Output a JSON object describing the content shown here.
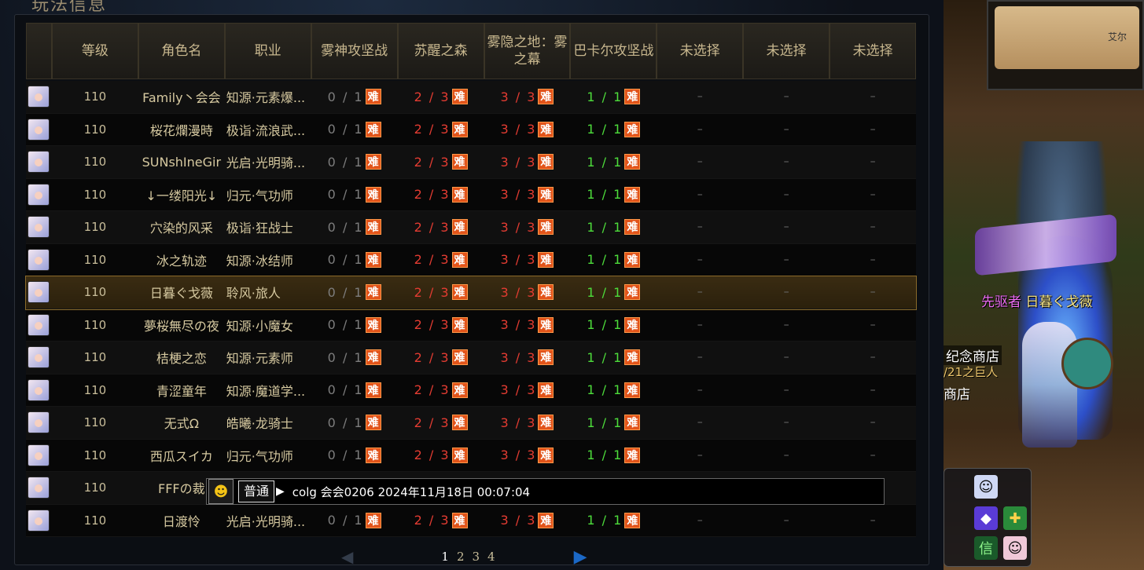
{
  "panel": {
    "title": "玩法信息"
  },
  "headers": [
    "等级",
    "角色名",
    "职业",
    "雾神攻坚战",
    "苏醒之森",
    "雾隐之地：雾之幕",
    "巴卡尔攻坚战",
    "未选择",
    "未选择",
    "未选择"
  ],
  "hard_badge": "难",
  "rows": [
    {
      "level": "110",
      "name": "Family丶会会",
      "job": "知源·元素爆...",
      "r1": "0 / 1",
      "r2": "2 / 3",
      "r3": "3 / 3",
      "r4": "1 / 1",
      "d1": "–",
      "d2": "–",
      "d3": "–"
    },
    {
      "level": "110",
      "name": "桜花爛漫時",
      "job": "极诣·流浪武...",
      "r1": "0 / 1",
      "r2": "2 / 3",
      "r3": "3 / 3",
      "r4": "1 / 1",
      "d1": "–",
      "d2": "–",
      "d3": "–"
    },
    {
      "level": "110",
      "name": "SUNshIneGir",
      "job": "光启·光明骑...",
      "r1": "0 / 1",
      "r2": "2 / 3",
      "r3": "3 / 3",
      "r4": "1 / 1",
      "d1": "–",
      "d2": "–",
      "d3": "–"
    },
    {
      "level": "110",
      "name": "↓一缕阳光↓",
      "job": "归元·气功师",
      "r1": "0 / 1",
      "r2": "2 / 3",
      "r3": "3 / 3",
      "r4": "1 / 1",
      "d1": "–",
      "d2": "–",
      "d3": "–"
    },
    {
      "level": "110",
      "name": "穴染的风采",
      "job": "极诣·狂战士",
      "r1": "0 / 1",
      "r2": "2 / 3",
      "r3": "3 / 3",
      "r4": "1 / 1",
      "d1": "–",
      "d2": "–",
      "d3": "–"
    },
    {
      "level": "110",
      "name": "冰之轨迹",
      "job": "知源·冰结师",
      "r1": "0 / 1",
      "r2": "2 / 3",
      "r3": "3 / 3",
      "r4": "1 / 1",
      "d1": "–",
      "d2": "–",
      "d3": "–"
    },
    {
      "level": "110",
      "name": "日暮ぐ戈薇",
      "job": "聆风·旅人",
      "r1": "0 / 1",
      "r2": "2 / 3",
      "r3": "3 / 3",
      "r4": "1 / 1",
      "d1": "–",
      "d2": "–",
      "d3": "–",
      "selected": true
    },
    {
      "level": "110",
      "name": "夢桜無尽の夜",
      "job": "知源·小魔女",
      "r1": "0 / 1",
      "r2": "2 / 3",
      "r3": "3 / 3",
      "r4": "1 / 1",
      "d1": "–",
      "d2": "–",
      "d3": "–"
    },
    {
      "level": "110",
      "name": "桔梗之恋",
      "job": "知源·元素师",
      "r1": "0 / 1",
      "r2": "2 / 3",
      "r3": "3 / 3",
      "r4": "1 / 1",
      "d1": "–",
      "d2": "–",
      "d3": "–"
    },
    {
      "level": "110",
      "name": "青涩童年",
      "job": "知源·魔道学...",
      "r1": "0 / 1",
      "r2": "2 / 3",
      "r3": "3 / 3",
      "r4": "1 / 1",
      "d1": "–",
      "d2": "–",
      "d3": "–"
    },
    {
      "level": "110",
      "name": "无式Ω",
      "job": "皓曦·龙骑士",
      "r1": "0 / 1",
      "r2": "2 / 3",
      "r3": "3 / 3",
      "r4": "1 / 1",
      "d1": "–",
      "d2": "–",
      "d3": "–"
    },
    {
      "level": "110",
      "name": "西瓜スイカ",
      "job": "归元·气功师",
      "r1": "0 / 1",
      "r2": "2 / 3",
      "r3": "3 / 3",
      "r4": "1 / 1",
      "d1": "–",
      "d2": "–",
      "d3": "–"
    },
    {
      "level": "110",
      "name": "FFFの裁",
      "job": "",
      "r1": "",
      "r2": "",
      "r3": "",
      "r4": "",
      "d1": "–",
      "d2": "–",
      "d3": "–"
    },
    {
      "level": "110",
      "name": "日渡怜",
      "job": "光启·光明骑...",
      "r1": "0 / 1",
      "r2": "2 / 3",
      "r3": "3 / 3",
      "r4": "1 / 1",
      "d1": "–",
      "d2": "–",
      "d3": "–"
    }
  ],
  "chat": {
    "channel": "普通",
    "text": "colg 会会0206  2024年11月18日  00:07:04"
  },
  "pager": {
    "pages": [
      "1",
      "2",
      "3",
      "4"
    ],
    "current": "1"
  },
  "game": {
    "minimap_label": "艾尔",
    "char_title": "先驱者",
    "char_name": "日暮ぐ戈薇",
    "npc_shop": "纪念商店",
    "npc_sub": "/21之巨人",
    "npc_shop2": "商店"
  },
  "colors": {
    "gray": "#7d7d7d",
    "red": "#e43c32",
    "green": "#4ddd3b",
    "hard_badge": "#e2541a",
    "header_text": "#c9b88f"
  }
}
